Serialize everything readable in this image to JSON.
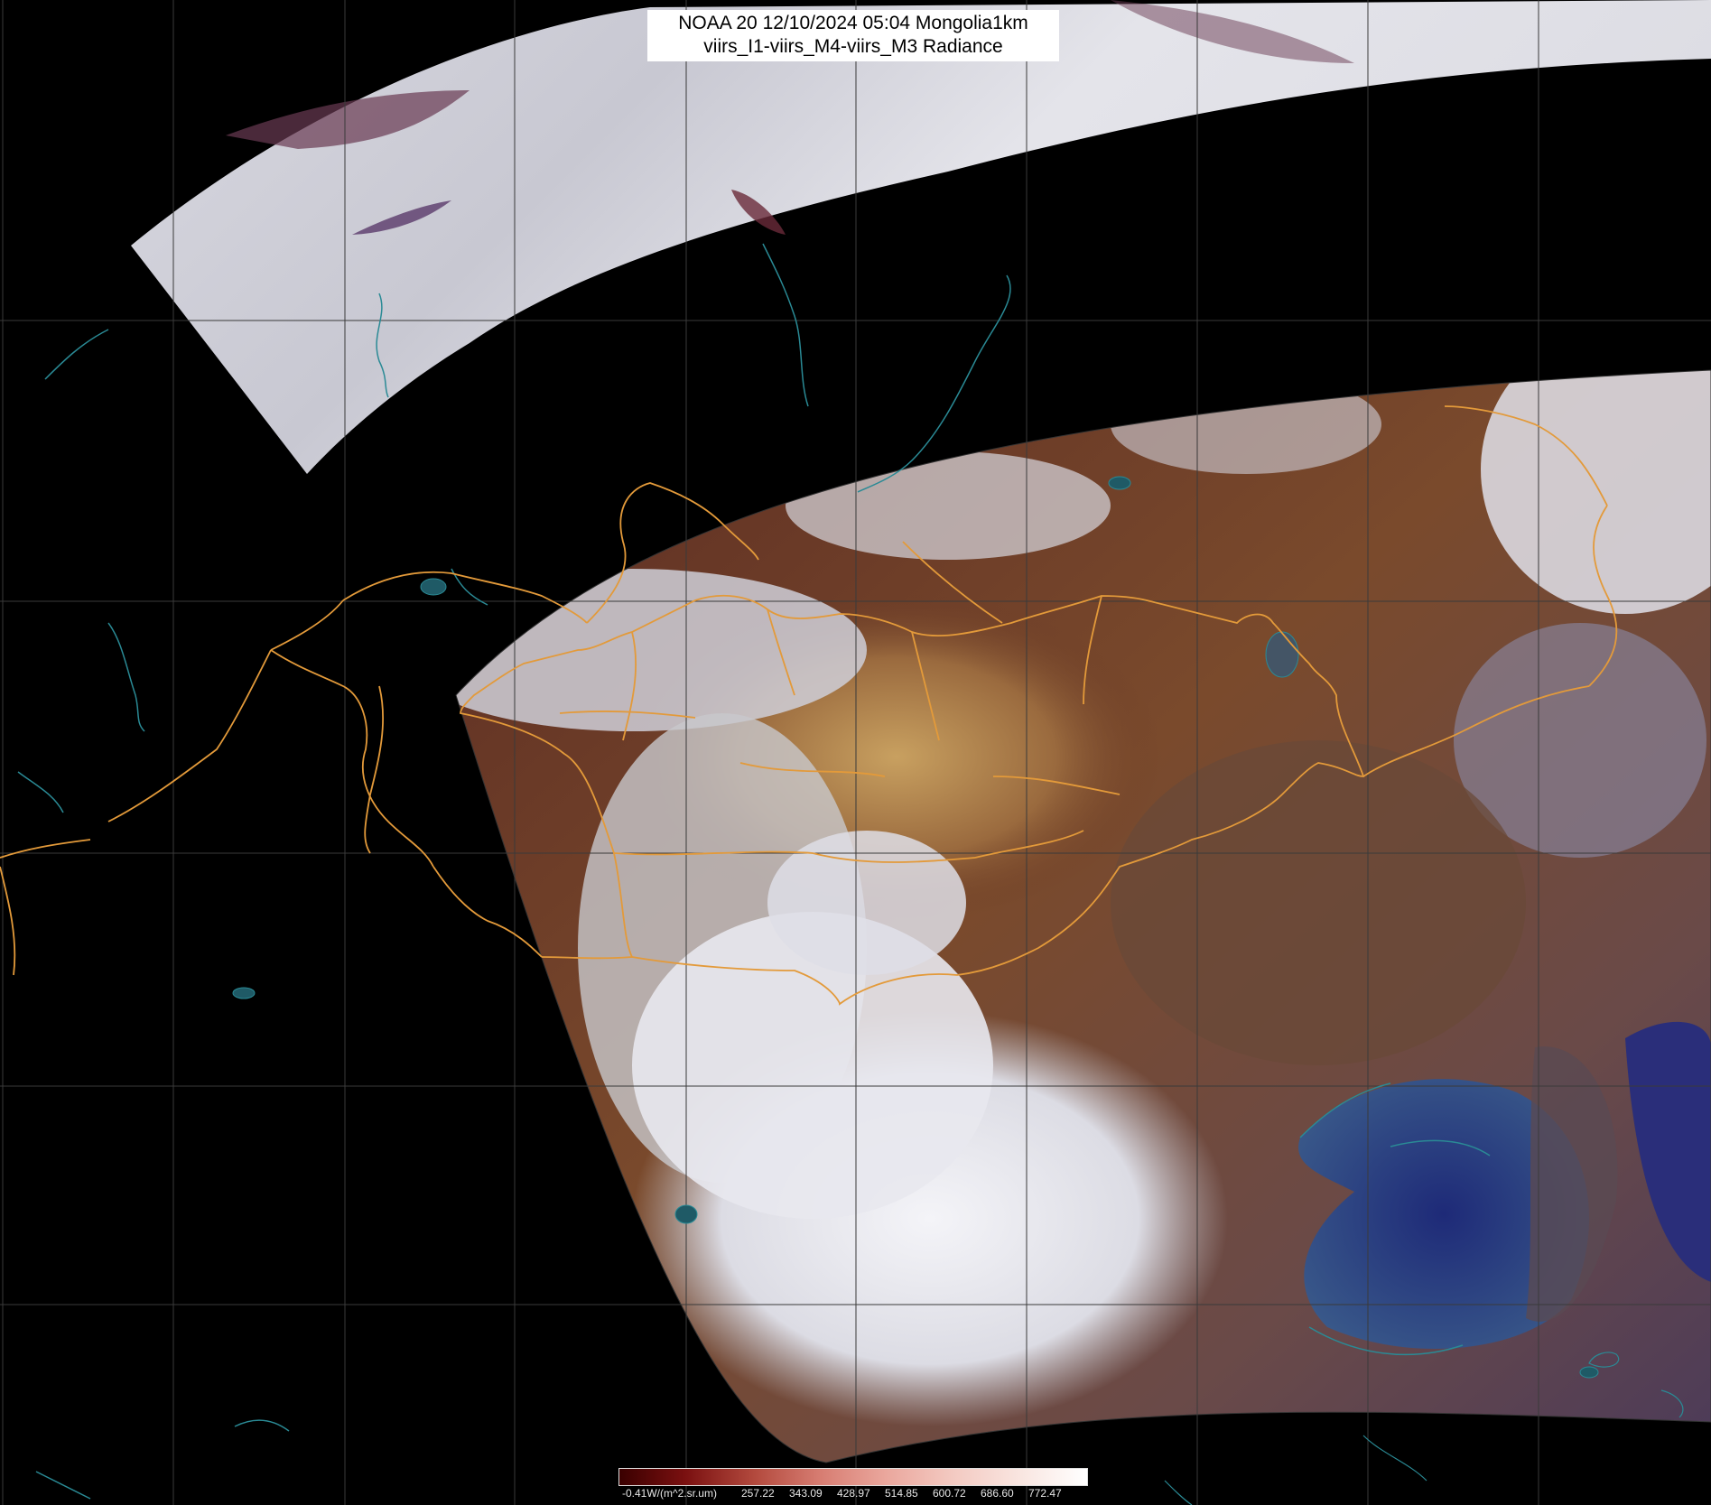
{
  "title": {
    "line1": "NOAA 20 12/10/2024 05:04 Mongolia1km",
    "line2": "viirs_I1-viirs_M4-viirs_M3 Radiance"
  },
  "colorbar": {
    "unit_label": "-0.41W/(m^2.sr.um)",
    "ticks": [
      "257.22",
      "343.09",
      "428.97",
      "514.85",
      "600.72",
      "686.60",
      "772.47"
    ],
    "colors": [
      "#3a0000",
      "#7a1010",
      "#b34a3e",
      "#d77d72",
      "#eaa79d",
      "#f3c9c1",
      "#f9e6e1",
      "#ffffff"
    ]
  },
  "map_colors": {
    "background": "#000000",
    "grid": "#3a3a3a",
    "country_border": "#e39a3a",
    "coastline": "#2a8a95",
    "cloud": "#e8e8ee",
    "land_dark": "#4a1e1e",
    "land_brown": "#7a4a2a",
    "desert": "#b08a55",
    "sea": "#24307a"
  }
}
